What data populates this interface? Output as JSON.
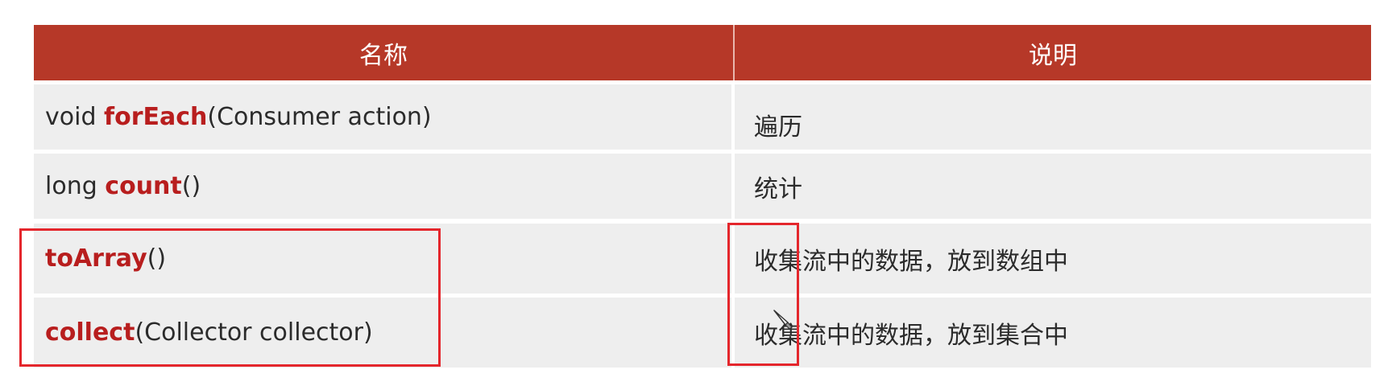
{
  "table": {
    "headers": [
      "名称",
      "说明"
    ],
    "rows": [
      {
        "prefix": "void ",
        "method": "forEach",
        "params": "(Consumer action)",
        "description": "遍历"
      },
      {
        "prefix": "long ",
        "method": "count",
        "params": "()",
        "description": "统计"
      },
      {
        "prefix": "",
        "method": "toArray",
        "params": "()",
        "description": "收集流中的数据，放到数组中"
      },
      {
        "prefix": "",
        "method": "collect",
        "params": "(Collector collector)",
        "description": "收集流中的数据，放到集合中"
      }
    ]
  },
  "colors": {
    "header_bg": "#b63828",
    "row_bg": "#eeeeee",
    "keyword": "#b81e1e",
    "highlight_box": "#e4262c"
  },
  "icons": [
    "pen-cursor-icon"
  ]
}
